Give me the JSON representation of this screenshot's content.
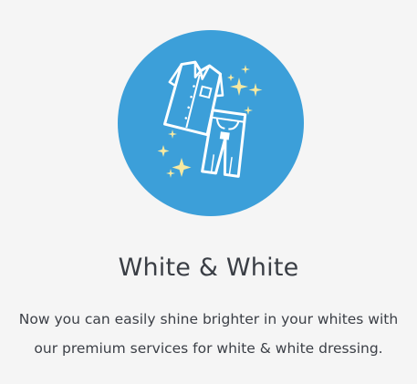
{
  "service": {
    "icon": "shirt-and-jeans-sparkle-icon",
    "title": "White & White",
    "description_lines": [
      "Now you can easily shine brighter in your whites with",
      "our premium services for white & white dressing."
    ]
  },
  "colors": {
    "background": "#f5f5f5",
    "circle": "#3c9fd9",
    "garment": "#ffffff",
    "sparkle": "#f7e9a0",
    "text": "#3b3f46"
  }
}
